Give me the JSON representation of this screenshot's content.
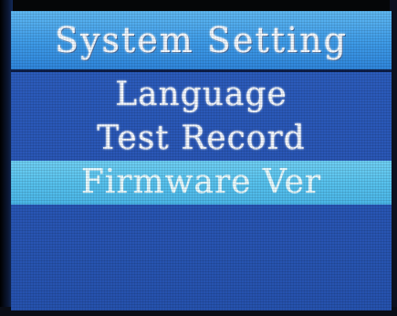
{
  "screen": {
    "title": "System Setting",
    "menu": [
      {
        "label": "Language",
        "selected": false
      },
      {
        "label": "Test Record",
        "selected": false
      },
      {
        "label": "Firmware Ver",
        "selected": true
      }
    ]
  },
  "colors": {
    "title_bar": "#3e9be8",
    "background": "#2a58b8",
    "highlight": "#58c2ee",
    "text": "#f4f8ff"
  }
}
